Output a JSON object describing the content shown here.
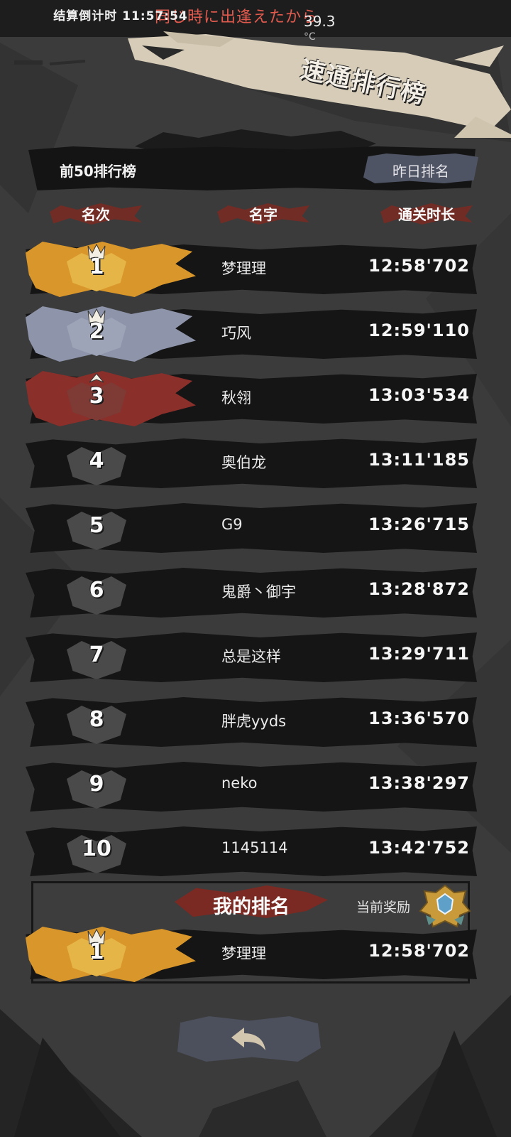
{
  "status_bar": {
    "song_text": "同じ時に出逢えたから",
    "temperature": "39.3",
    "temperature_unit": "°C"
  },
  "page": {
    "title": "速通排行榜",
    "countdown_label": "结算倒计时",
    "countdown_time": "11:57:54",
    "leaderboard_title": "前50排行榜",
    "yesterday_button": "昨日排名"
  },
  "columns": {
    "rank": "名次",
    "name": "名字",
    "time": "通关时长"
  },
  "rows": [
    {
      "rank": "1",
      "name": "梦理理",
      "time": "12:58'702",
      "tier": "gold"
    },
    {
      "rank": "2",
      "name": "巧风",
      "time": "12:59'110",
      "tier": "silver"
    },
    {
      "rank": "3",
      "name": "秋翎",
      "time": "13:03'534",
      "tier": "bronze"
    },
    {
      "rank": "4",
      "name": "奥伯龙",
      "time": "13:11'185",
      "tier": "normal"
    },
    {
      "rank": "5",
      "name": "G9",
      "time": "13:26'715",
      "tier": "normal"
    },
    {
      "rank": "6",
      "name": "鬼爵丶御宇",
      "time": "13:28'872",
      "tier": "normal"
    },
    {
      "rank": "7",
      "name": "总是这样",
      "time": "13:29'711",
      "tier": "normal"
    },
    {
      "rank": "8",
      "name": "胖虎yyds",
      "time": "13:36'570",
      "tier": "normal"
    },
    {
      "rank": "9",
      "name": "neko",
      "time": "13:38'297",
      "tier": "normal"
    },
    {
      "rank": "10",
      "name": "1145114",
      "time": "13:42'752",
      "tier": "normal"
    }
  ],
  "my_rank": {
    "title": "我的排名",
    "reward_label": "当前奖励",
    "rank": "1",
    "name": "梦理理",
    "time": "12:58'702",
    "tier": "gold"
  },
  "icons": {
    "back": "back-arrow-icon",
    "reward": "reward-badge-icon",
    "crown": "crown-icon"
  },
  "colors": {
    "gold": "#d9962a",
    "silver": "#8e95ab",
    "bronze": "#8a2f2a",
    "accent_red": "#e05a4e"
  }
}
